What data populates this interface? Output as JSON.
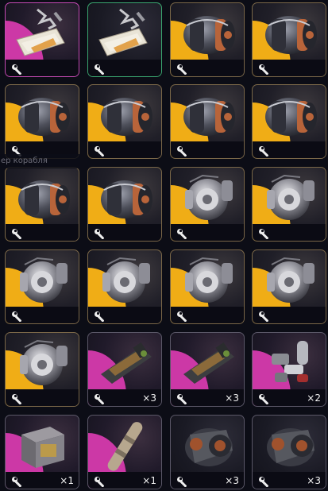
{
  "ghost_text": "ер корабля",
  "colors": {
    "orange_wedge": "#f0ad16",
    "magenta_wedge": "#cc38a6",
    "gold_border": "#7a6748",
    "green_border": "#3aa66f",
    "pink_border": "#c44ab3"
  },
  "items": [
    {
      "name": "tile-blueprint-1",
      "icon": "blueprint-icon",
      "wedge": "magenta",
      "border": "pink",
      "qty": ""
    },
    {
      "name": "tile-blueprint-2",
      "icon": "blueprint-icon",
      "wedge": "none",
      "border": "green",
      "qty": ""
    },
    {
      "name": "tile-thruster-1",
      "icon": "thruster-icon",
      "wedge": "orange",
      "border": "gold",
      "qty": ""
    },
    {
      "name": "tile-thruster-2",
      "icon": "thruster-icon",
      "wedge": "orange",
      "border": "gold",
      "qty": ""
    },
    {
      "name": "tile-thruster-3",
      "icon": "thruster-icon",
      "wedge": "orange",
      "border": "gold",
      "qty": ""
    },
    {
      "name": "tile-thruster-4",
      "icon": "thruster-icon",
      "wedge": "orange",
      "border": "gold",
      "qty": ""
    },
    {
      "name": "tile-thruster-5",
      "icon": "thruster-icon",
      "wedge": "orange",
      "border": "gold",
      "qty": ""
    },
    {
      "name": "tile-thruster-6",
      "icon": "thruster-icon",
      "wedge": "orange",
      "border": "gold",
      "qty": ""
    },
    {
      "name": "tile-thruster-7",
      "icon": "thruster-icon",
      "wedge": "orange",
      "border": "gold",
      "qty": ""
    },
    {
      "name": "tile-thruster-8",
      "icon": "thruster-icon",
      "wedge": "orange",
      "border": "gold",
      "qty": ""
    },
    {
      "name": "tile-reactor-1",
      "icon": "reactor-icon",
      "wedge": "orange",
      "border": "gold",
      "qty": ""
    },
    {
      "name": "tile-reactor-2",
      "icon": "reactor-icon",
      "wedge": "orange",
      "border": "gold",
      "qty": ""
    },
    {
      "name": "tile-reactor-3",
      "icon": "reactor-icon",
      "wedge": "orange",
      "border": "gold",
      "qty": ""
    },
    {
      "name": "tile-reactor-4",
      "icon": "reactor-icon",
      "wedge": "orange",
      "border": "gold",
      "qty": ""
    },
    {
      "name": "tile-reactor-5",
      "icon": "reactor-icon",
      "wedge": "orange",
      "border": "gold",
      "qty": ""
    },
    {
      "name": "tile-reactor-6",
      "icon": "reactor-icon",
      "wedge": "orange",
      "border": "gold",
      "qty": ""
    },
    {
      "name": "tile-reactor-7",
      "icon": "reactor-icon",
      "wedge": "orange",
      "border": "gold",
      "qty": ""
    },
    {
      "name": "tile-weapon-1",
      "icon": "weapon-icon",
      "wedge": "magenta",
      "border": "grey",
      "qty": "×3"
    },
    {
      "name": "tile-weapon-2",
      "icon": "weapon-icon",
      "wedge": "magenta",
      "border": "grey",
      "qty": "×3"
    },
    {
      "name": "tile-parts-1",
      "icon": "parts-icon",
      "wedge": "magenta",
      "border": "grey",
      "qty": "×2"
    },
    {
      "name": "tile-crate-1",
      "icon": "crate-icon",
      "wedge": "magenta",
      "border": "grey",
      "qty": "×1"
    },
    {
      "name": "tile-rod-1",
      "icon": "rod-icon",
      "wedge": "magenta",
      "border": "grey",
      "qty": "×1"
    },
    {
      "name": "tile-engine-1",
      "icon": "engine-icon",
      "wedge": "none",
      "border": "grey",
      "qty": "×3"
    },
    {
      "name": "tile-engine-2",
      "icon": "engine-icon",
      "wedge": "none",
      "border": "grey",
      "qty": "×3"
    }
  ]
}
